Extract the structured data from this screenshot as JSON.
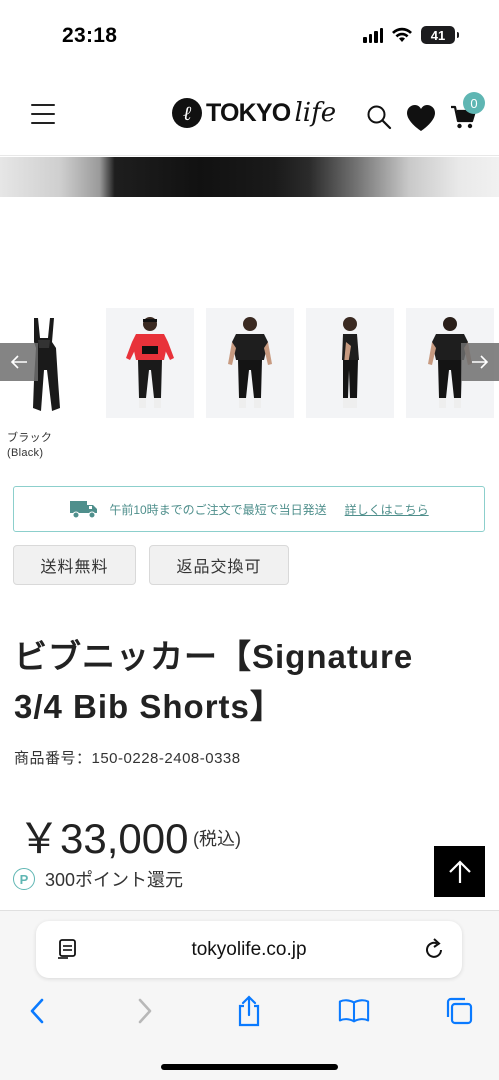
{
  "status_bar": {
    "time": "23:18",
    "battery": "41"
  },
  "header": {
    "logo_main": "TOKYO",
    "logo_script": "life",
    "logo_mark": "ℓ",
    "cart_count": "0"
  },
  "gallery": {
    "color_label_line1": "ブラック",
    "color_label_line2": "(Black)",
    "thumbnails": [
      "bib-black",
      "model-red-front",
      "model-black-front",
      "model-black-side",
      "model-black-back"
    ]
  },
  "shipping": {
    "text": "午前10時までのご注文で最短で当日発送",
    "link": "詳しくはこちら"
  },
  "tags": [
    "送料無料",
    "返品交換可"
  ],
  "product": {
    "title_line1": "ビブニッカー【Signature",
    "title_line2": "3/4 Bib Shorts】",
    "code": "商品番号：150-0228-2408-0338",
    "price": "￥33,000",
    "tax_note": "(税込)",
    "points_icon": "P",
    "points": "300ポイント還元"
  },
  "browser": {
    "url": "tokyolife.co.jp"
  },
  "colors": {
    "accent": "#5fb6b3",
    "ios_blue": "#0a7aff"
  }
}
